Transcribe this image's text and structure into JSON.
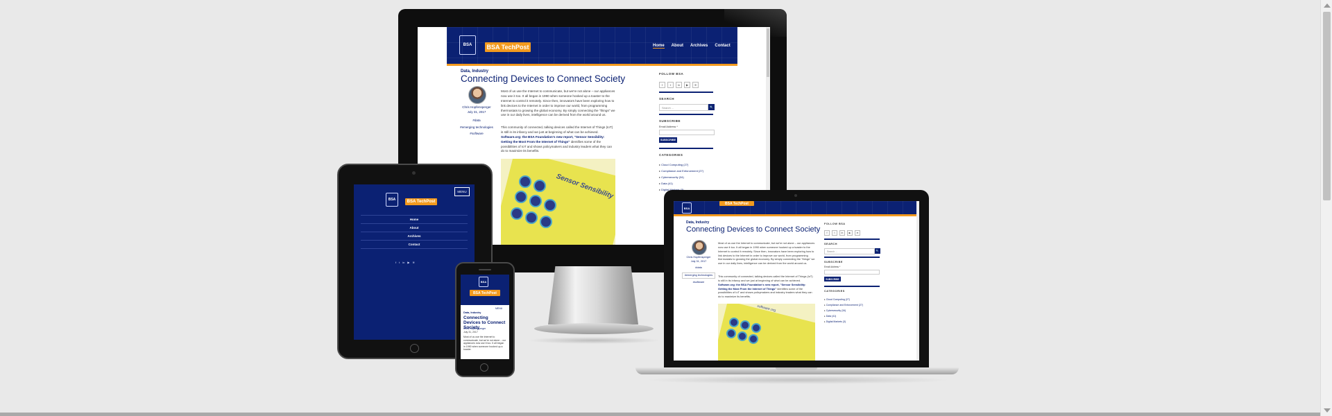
{
  "site": {
    "brand": "BSA TechPost",
    "logo_text": "BSA",
    "nav": [
      "Home",
      "About",
      "Archives",
      "Contact"
    ],
    "menu_button": "MENU"
  },
  "post": {
    "category": "Data, Industry",
    "title": "Connecting Devices to Connect Society",
    "title_mobile": "Connecting Devices to Connect Society",
    "author": "Chris Hopfensperger",
    "date": "July 31, 2017",
    "tags": [
      "#data",
      "#emerging technologies",
      "#software"
    ],
    "paragraph1": "Most of us use the Internet to communicate, but we're not alone – our appliances now use it too. It all began in 1990 when someone hooked up a toaster to the Internet to control it remotely. Since then, innovators have been exploring how to link devices to the Internet in order to improve our world, from programming thermostats to growing the global economy. By simply connecting the \"things\" we use in our daily lives, intelligence can be derived from the world around us.",
    "paragraph2_a": "This community of connected, talking devices called the Internet of Things (IoT) is still in its infancy and we just at beginning of what can be achieved.",
    "paragraph2_link": "Software.org: the BSA Foundation's new report, \"Sensor Sensibility: Getting the Most From the Internet of Things\"",
    "paragraph2_b": "identifies some of the possibilities of IoT and shows policymakers and industry leaders what they can do to maximize its benefits.",
    "mobile_excerpt": "Most of us use the Internet to communicate, but we're not alone – our appliances now use it too. It all began in 1990 when someone hooked up a toaster."
  },
  "sidebar": {
    "follow": "FOLLOW BSA",
    "social_icons": [
      "facebook-icon",
      "twitter-icon",
      "linkedin-icon",
      "youtube-icon",
      "rss-icon"
    ],
    "social_glyphs": [
      "f",
      "t",
      "in",
      "▶",
      "≋"
    ],
    "search_label": "SEARCH",
    "search_placeholder": "Search ...",
    "search_button": "🔍",
    "subscribe_label": "SUBSCRIBE",
    "email_label": "Email Address *",
    "subscribe_button": "SUBSCRIBE",
    "categories_label": "CATEGORIES",
    "categories": [
      "Cloud Computing (27)",
      "Compliance and Enforcement (27)",
      "Cybersecurity (34)",
      "Data (41)",
      "Digital Markets (3)"
    ]
  },
  "book": {
    "brand": "software.org",
    "title": "Sensor Sensibility"
  }
}
